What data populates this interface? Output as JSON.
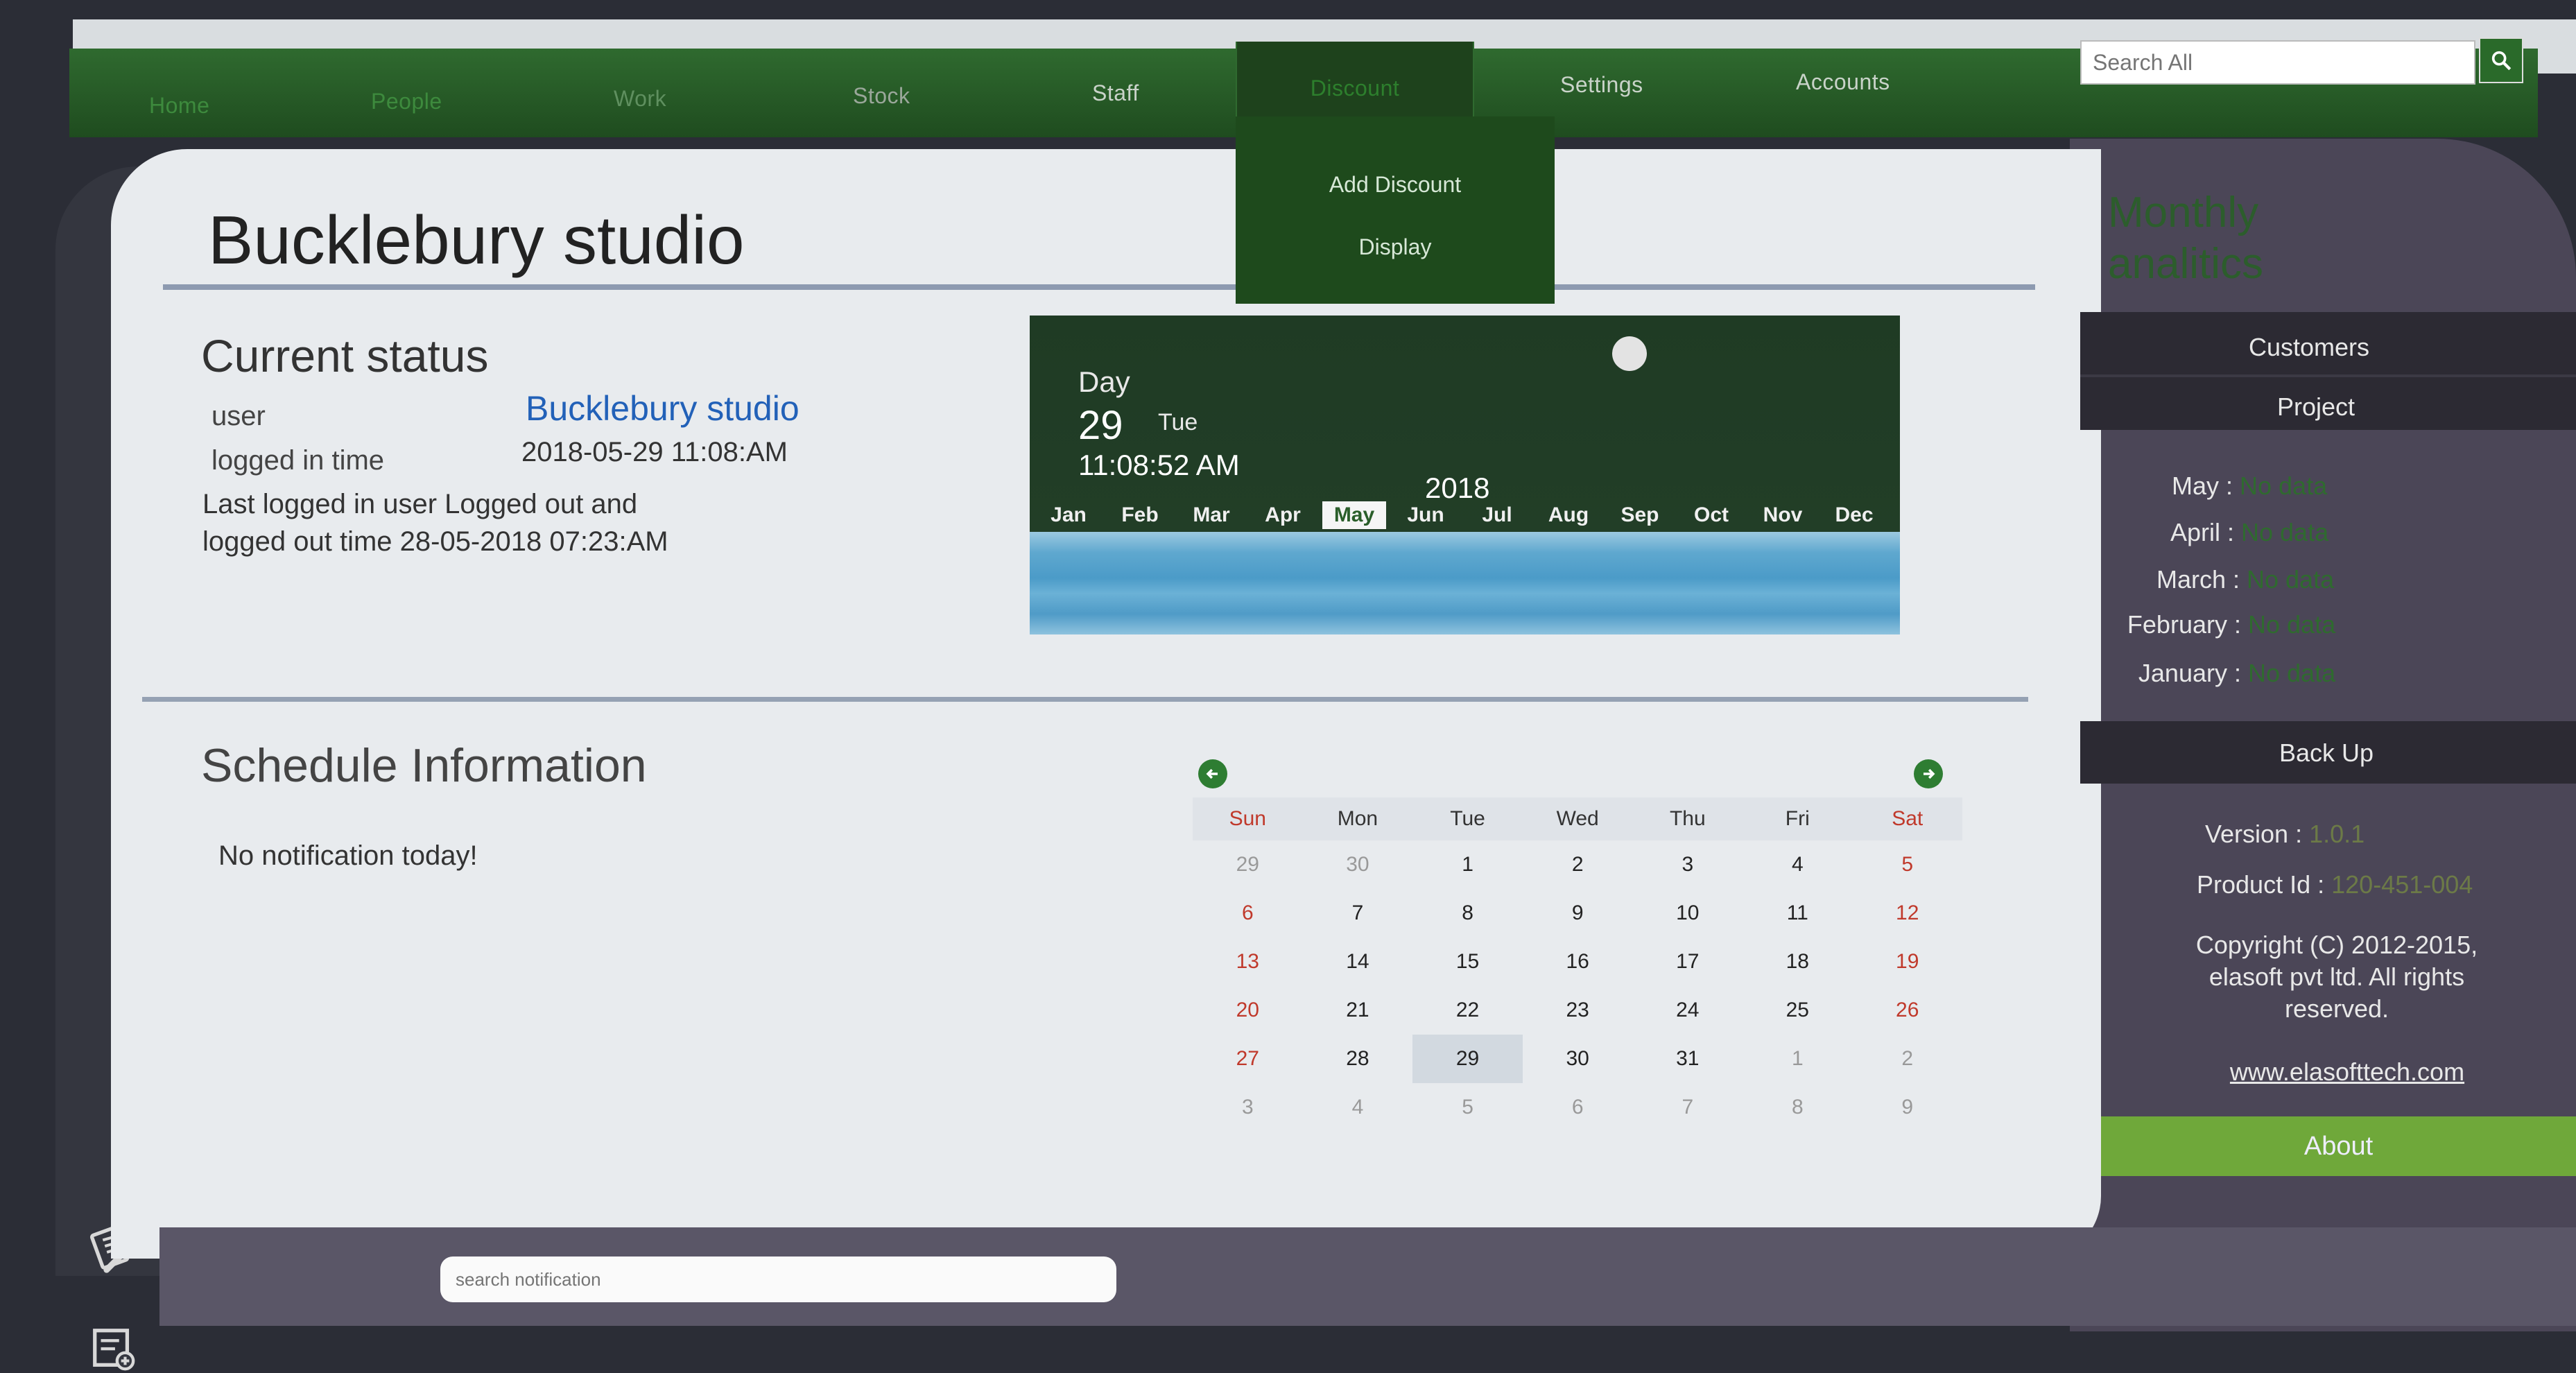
{
  "nav": {
    "items": [
      "Home",
      "People",
      "Work",
      "Stock",
      "Staff",
      "Discount",
      "Settings",
      "Accounts"
    ],
    "search_placeholder": "Search All"
  },
  "dropdown": {
    "items": [
      "Add Discount",
      "Display"
    ]
  },
  "main": {
    "title": "Bucklebury studio",
    "status": {
      "heading": "Current status",
      "user_label": "user",
      "user_value": "Bucklebury studio",
      "login_label": "logged in time",
      "login_value": "2018-05-29 11:08:AM",
      "last_logged_text": "Last logged in user Logged out and logged out time 28-05-2018 07:23:AM"
    },
    "clock": {
      "day_label": "Day",
      "day_number": "29",
      "weekday": "Tue",
      "time": "11:08:52 AM",
      "year": "2018",
      "months": [
        "Jan",
        "Feb",
        "Mar",
        "Apr",
        "May",
        "Jun",
        "Jul",
        "Aug",
        "Sep",
        "Oct",
        "Nov",
        "Dec"
      ],
      "active_month": "May"
    },
    "schedule": {
      "heading": "Schedule Information",
      "empty_message": "No notification today!"
    },
    "calendar": {
      "weekdays": [
        "Sun",
        "Mon",
        "Tue",
        "Wed",
        "Thu",
        "Fri",
        "Sat"
      ],
      "weeks": [
        [
          "29",
          "30",
          "1",
          "2",
          "3",
          "4",
          "5"
        ],
        [
          "6",
          "7",
          "8",
          "9",
          "10",
          "11",
          "12"
        ],
        [
          "13",
          "14",
          "15",
          "16",
          "17",
          "18",
          "19"
        ],
        [
          "20",
          "21",
          "22",
          "23",
          "24",
          "25",
          "26"
        ],
        [
          "27",
          "28",
          "29",
          "30",
          "31",
          "1",
          "2"
        ],
        [
          "3",
          "4",
          "5",
          "6",
          "7",
          "8",
          "9"
        ]
      ],
      "today": "29"
    }
  },
  "analytics": {
    "title_line1": "Monthly",
    "title_line2": "analitics",
    "customers_label": "Customers",
    "project_label": "Project",
    "months": [
      {
        "label": "May :",
        "value": "No data"
      },
      {
        "label": "April :",
        "value": "No data"
      },
      {
        "label": "March :",
        "value": "No data"
      },
      {
        "label": "February :",
        "value": "No data"
      },
      {
        "label": "January :",
        "value": "No data"
      }
    ],
    "backup_label": "Back Up",
    "version_label": "Version :",
    "version_value": "1.0.1",
    "product_label": "Product Id :",
    "product_value": "120-451-004",
    "copyright": "Copyright (C) 2012-2015, elasoft pvt ltd. All rights reserved.",
    "website": "www.elasofttech.com",
    "about_label": "About"
  },
  "footer": {
    "search_placeholder": "search notification"
  },
  "icons": {
    "search": "magnifier-icon",
    "prev": "arrow-left-icon",
    "next": "arrow-right-icon",
    "rail": [
      "notepad-icon",
      "list-add-icon",
      "wrench-icon",
      "logout-icon"
    ]
  },
  "colors": {
    "nav_green": "#2f6a2f",
    "accent_blue": "#2261b8",
    "about_green": "#6fa83a",
    "weekend_red": "#c0392b"
  }
}
